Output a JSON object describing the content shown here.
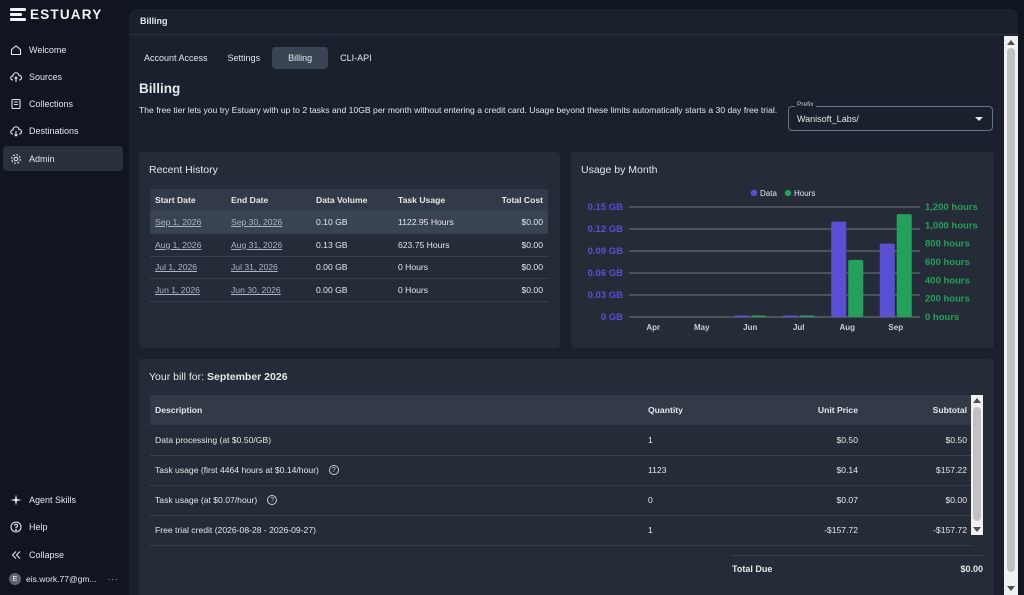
{
  "brand": {
    "name": "ESTUARY"
  },
  "sidebar": {
    "items": [
      {
        "label": "Welcome",
        "icon": "home-icon"
      },
      {
        "label": "Sources",
        "icon": "upload-cloud-icon"
      },
      {
        "label": "Collections",
        "icon": "collections-icon"
      },
      {
        "label": "Destinations",
        "icon": "download-cloud-icon"
      },
      {
        "label": "Admin",
        "icon": "gear-icon",
        "active": true
      }
    ],
    "bottom_items": [
      {
        "label": "Agent Skills",
        "icon": "sparkle-icon"
      },
      {
        "label": "Help",
        "icon": "help-icon"
      },
      {
        "label": "Collapse",
        "icon": "collapse-icon"
      }
    ],
    "user": {
      "initial": "E",
      "email": "eis.work.77@gm...",
      "more": "···"
    }
  },
  "header": {
    "title": "Billing"
  },
  "tabs": [
    {
      "label": "Account Access"
    },
    {
      "label": "Settings"
    },
    {
      "label": "Billing",
      "active": true
    },
    {
      "label": "CLI-API"
    }
  ],
  "billing": {
    "title": "Billing",
    "description": "The free tier lets you try Estuary with up to 2 tasks and 10GB per month without entering a credit card. Usage beyond these limits automatically starts a 30 day free trial.",
    "prefix_label": "Prefix",
    "prefix_value": "Wanisoft_Labs/"
  },
  "history": {
    "title": "Recent History",
    "columns": [
      "Start Date",
      "End Date",
      "Data Volume",
      "Task Usage",
      "Total Cost"
    ],
    "rows": [
      [
        "Sep 1, 2026",
        "Sep 30, 2026",
        "0.10 GB",
        "1122.95 Hours",
        "$0.00"
      ],
      [
        "Aug 1, 2026",
        "Aug 31, 2026",
        "0.13 GB",
        "623.75 Hours",
        "$0.00"
      ],
      [
        "Jul 1, 2026",
        "Jul 31, 2026",
        "0.00 GB",
        "0 Hours",
        "$0.00"
      ],
      [
        "Jun 1, 2026",
        "Jun 30, 2026",
        "0.00 GB",
        "0 Hours",
        "$0.00"
      ]
    ]
  },
  "chart_data": {
    "type": "bar",
    "title": "Usage by Month",
    "categories": [
      "Apr",
      "May",
      "Jun",
      "Jul",
      "Aug",
      "Sep"
    ],
    "series": [
      {
        "name": "Data",
        "unit": "GB",
        "color": "#5b4fd6",
        "values": [
          0,
          0,
          0.002,
          0.002,
          0.13,
          0.1
        ]
      },
      {
        "name": "Hours",
        "unit": "hours",
        "color": "#23a05a",
        "values": [
          0,
          0,
          5,
          5,
          623.75,
          1122.95
        ]
      }
    ],
    "left_axis": {
      "ylim": [
        0,
        0.15
      ],
      "ticks": [
        "0 GB",
        "0.03 GB",
        "0.06 GB",
        "0.09 GB",
        "0.12 GB",
        "0.15 GB"
      ],
      "color": "#5b4fd6"
    },
    "right_axis": {
      "ylim": [
        0,
        1200
      ],
      "ticks": [
        "0 hours",
        "200 hours",
        "400 hours",
        "600 hours",
        "800 hours",
        "1,000 hours",
        "1,200 hours"
      ],
      "color": "#23a05a"
    },
    "legend_position": "top-center",
    "grid": true
  },
  "bill": {
    "title_prefix": "Your bill for: ",
    "period": "September 2026",
    "columns": [
      "Description",
      "Quantity",
      "Unit Price",
      "Subtotal"
    ],
    "rows": [
      {
        "description": "Data processing (at $0.50/GB)",
        "quantity": "1",
        "unit_price": "$0.50",
        "subtotal": "$0.50",
        "help": false
      },
      {
        "description": "Task usage (first 4464 hours at $0.14/hour)",
        "quantity": "1123",
        "unit_price": "$0.14",
        "subtotal": "$157.22",
        "help": true
      },
      {
        "description": "Task usage (at $0.07/hour)",
        "quantity": "0",
        "unit_price": "$0.07",
        "subtotal": "$0.00",
        "help": true
      },
      {
        "description": "Free trial credit (2026-08-28 - 2026-09-27)",
        "quantity": "1",
        "unit_price": "-$157.72",
        "subtotal": "-$157.72",
        "help": false
      }
    ],
    "total_label": "Total Due",
    "total_value": "$0.00"
  }
}
